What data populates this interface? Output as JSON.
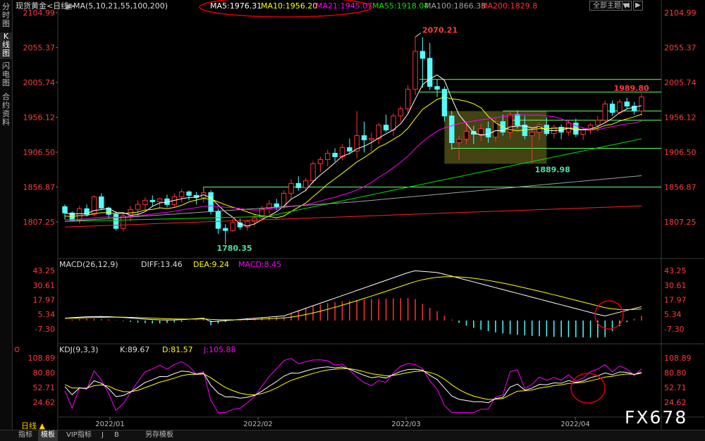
{
  "side_tabs": [
    {
      "label": "分时图",
      "active": false
    },
    {
      "label": "K线图",
      "active": true
    },
    {
      "label": "闪电图",
      "active": false
    },
    {
      "label": "合约资料",
      "active": false
    }
  ],
  "header": {
    "instrument": "现货黄金<日线>",
    "ma_label": "MA(5,10,21,55,100,200)",
    "ma5": "MA5:1976.31",
    "ma10": "MA10:1956.20",
    "ma21": "MA21:1945.07",
    "ma55": "MA55:1918.04",
    "ma100": "MA100:1866.38",
    "ma200": "MA200:1829.8",
    "theme_label": "全部主题",
    "theme_arrow": "▼"
  },
  "colors": {
    "up": "#ff3232",
    "down": "#54fcfc",
    "ma5": "#ffffff",
    "ma10": "#ffff00",
    "ma21": "#ff00ff",
    "ma55": "#00e600",
    "ma100": "#a0a0a0",
    "ma200": "#ff2020",
    "label_red": "#ff3b3b",
    "support": "#66ff66",
    "annot": "#e00000",
    "box": "#5a5a1a"
  },
  "price_axis": {
    "left_ticks": [
      "2104.99",
      "2055.37",
      "2005.74",
      "1956.12",
      "1906.50",
      "1856.87",
      "1807.25"
    ],
    "right_ticks": [
      "2104.99",
      "2055.37",
      "2005.74",
      "1956.12",
      "1906.50",
      "1856.87",
      "1807.25"
    ]
  },
  "price_annotations": {
    "high": "2070.21",
    "low1": "1780.35",
    "low2": "1889.98",
    "last_high": "1989.80"
  },
  "macd": {
    "title": "MACD(26,12,9)",
    "diff": "DIFF:13.46",
    "dea": "DEA:9.24",
    "macd": "MACD:8.45",
    "ticks": [
      "43.25",
      "30.61",
      "17.97",
      "5.34",
      "-7.30"
    ]
  },
  "kdj": {
    "title": "KDJ(9,3,3)",
    "k": "K:89.67",
    "d": "D:81.57",
    "j": "J:105.88",
    "ticks": [
      "108.89",
      "80.80",
      "52.71",
      "24.62"
    ]
  },
  "dates": [
    "2022/01",
    "2022/02",
    "2022/03",
    "2022/04"
  ],
  "period_label": "日线 ▲",
  "bottom_tabs": [
    {
      "label": "指标",
      "active": false
    },
    {
      "label": "模板",
      "active": true
    },
    {
      "label": "VIP指标",
      "active": false
    },
    {
      "label": "J",
      "active": false
    },
    {
      "label": "B",
      "active": false
    },
    {
      "label": "另存模板",
      "active": false
    }
  ],
  "watermark": "FX678",
  "chart_data": {
    "type": "candlestick",
    "title": "现货黄金<日线>",
    "ylim": [
      1780,
      2110
    ],
    "candles": [
      [
        1829,
        1832,
        1811,
        1820
      ],
      [
        1820,
        1822,
        1808,
        1810
      ],
      [
        1810,
        1830,
        1805,
        1826
      ],
      [
        1826,
        1832,
        1815,
        1818
      ],
      [
        1818,
        1845,
        1815,
        1843
      ],
      [
        1843,
        1848,
        1825,
        1827
      ],
      [
        1827,
        1829,
        1812,
        1818
      ],
      [
        1818,
        1822,
        1795,
        1798
      ],
      [
        1798,
        1820,
        1794,
        1816
      ],
      [
        1816,
        1830,
        1808,
        1825
      ],
      [
        1825,
        1838,
        1816,
        1832
      ],
      [
        1832,
        1842,
        1824,
        1838
      ],
      [
        1838,
        1845,
        1830,
        1836
      ],
      [
        1836,
        1842,
        1826,
        1840
      ],
      [
        1840,
        1846,
        1828,
        1832
      ],
      [
        1832,
        1848,
        1829,
        1843
      ],
      [
        1843,
        1854,
        1835,
        1850
      ],
      [
        1850,
        1852,
        1838,
        1845
      ],
      [
        1845,
        1850,
        1832,
        1842
      ],
      [
        1842,
        1854,
        1835,
        1849
      ],
      [
        1849,
        1852,
        1818,
        1822
      ],
      [
        1822,
        1826,
        1790,
        1798
      ],
      [
        1798,
        1804,
        1780,
        1795
      ],
      [
        1795,
        1812,
        1793,
        1806
      ],
      [
        1806,
        1812,
        1796,
        1800
      ],
      [
        1800,
        1810,
        1795,
        1808
      ],
      [
        1808,
        1818,
        1801,
        1813
      ],
      [
        1813,
        1830,
        1808,
        1826
      ],
      [
        1826,
        1838,
        1818,
        1833
      ],
      [
        1833,
        1840,
        1824,
        1829
      ],
      [
        1829,
        1852,
        1826,
        1848
      ],
      [
        1848,
        1868,
        1840,
        1862
      ],
      [
        1862,
        1872,
        1852,
        1856
      ],
      [
        1856,
        1870,
        1850,
        1866
      ],
      [
        1866,
        1894,
        1862,
        1890
      ],
      [
        1890,
        1900,
        1878,
        1896
      ],
      [
        1896,
        1910,
        1886,
        1905
      ],
      [
        1905,
        1912,
        1893,
        1900
      ],
      [
        1900,
        1918,
        1895,
        1913
      ],
      [
        1913,
        1926,
        1904,
        1908
      ],
      [
        1908,
        1965,
        1898,
        1930
      ],
      [
        1930,
        1950,
        1906,
        1924
      ],
      [
        1924,
        1934,
        1908,
        1926
      ],
      [
        1926,
        1948,
        1918,
        1945
      ],
      [
        1945,
        1960,
        1935,
        1938
      ],
      [
        1938,
        1962,
        1930,
        1958
      ],
      [
        1958,
        1972,
        1950,
        1968
      ],
      [
        1968,
        2002,
        1962,
        1996
      ],
      [
        1996,
        2070,
        1988,
        2050
      ],
      [
        2050,
        2070,
        1998,
        2040
      ],
      [
        2040,
        2062,
        1995,
        2000
      ],
      [
        2000,
        2010,
        1985,
        1996
      ],
      [
        1996,
        2000,
        1950,
        1958
      ],
      [
        1958,
        1965,
        1910,
        1920
      ],
      [
        1920,
        1930,
        1895,
        1925
      ],
      [
        1925,
        1950,
        1918,
        1936
      ],
      [
        1936,
        1944,
        1918,
        1932
      ],
      [
        1932,
        1947,
        1922,
        1940
      ],
      [
        1940,
        1950,
        1920,
        1928
      ],
      [
        1928,
        1954,
        1922,
        1950
      ],
      [
        1950,
        1960,
        1930,
        1935
      ],
      [
        1935,
        1965,
        1926,
        1960
      ],
      [
        1960,
        1966,
        1940,
        1945
      ],
      [
        1945,
        1958,
        1925,
        1930
      ],
      [
        1930,
        1940,
        1890,
        1935
      ],
      [
        1935,
        1948,
        1924,
        1945
      ],
      [
        1945,
        1956,
        1930,
        1933
      ],
      [
        1933,
        1946,
        1926,
        1942
      ],
      [
        1942,
        1946,
        1925,
        1935
      ],
      [
        1935,
        1952,
        1930,
        1948
      ],
      [
        1948,
        1954,
        1928,
        1932
      ],
      [
        1932,
        1942,
        1924,
        1938
      ],
      [
        1938,
        1948,
        1932,
        1945
      ],
      [
        1945,
        1958,
        1936,
        1952
      ],
      [
        1952,
        1980,
        1948,
        1975
      ],
      [
        1975,
        1980,
        1958,
        1963
      ],
      [
        1963,
        1982,
        1960,
        1978
      ],
      [
        1978,
        1984,
        1968,
        1972
      ],
      [
        1972,
        1978,
        1960,
        1965
      ],
      [
        1965,
        1990,
        1958,
        1985
      ]
    ]
  }
}
